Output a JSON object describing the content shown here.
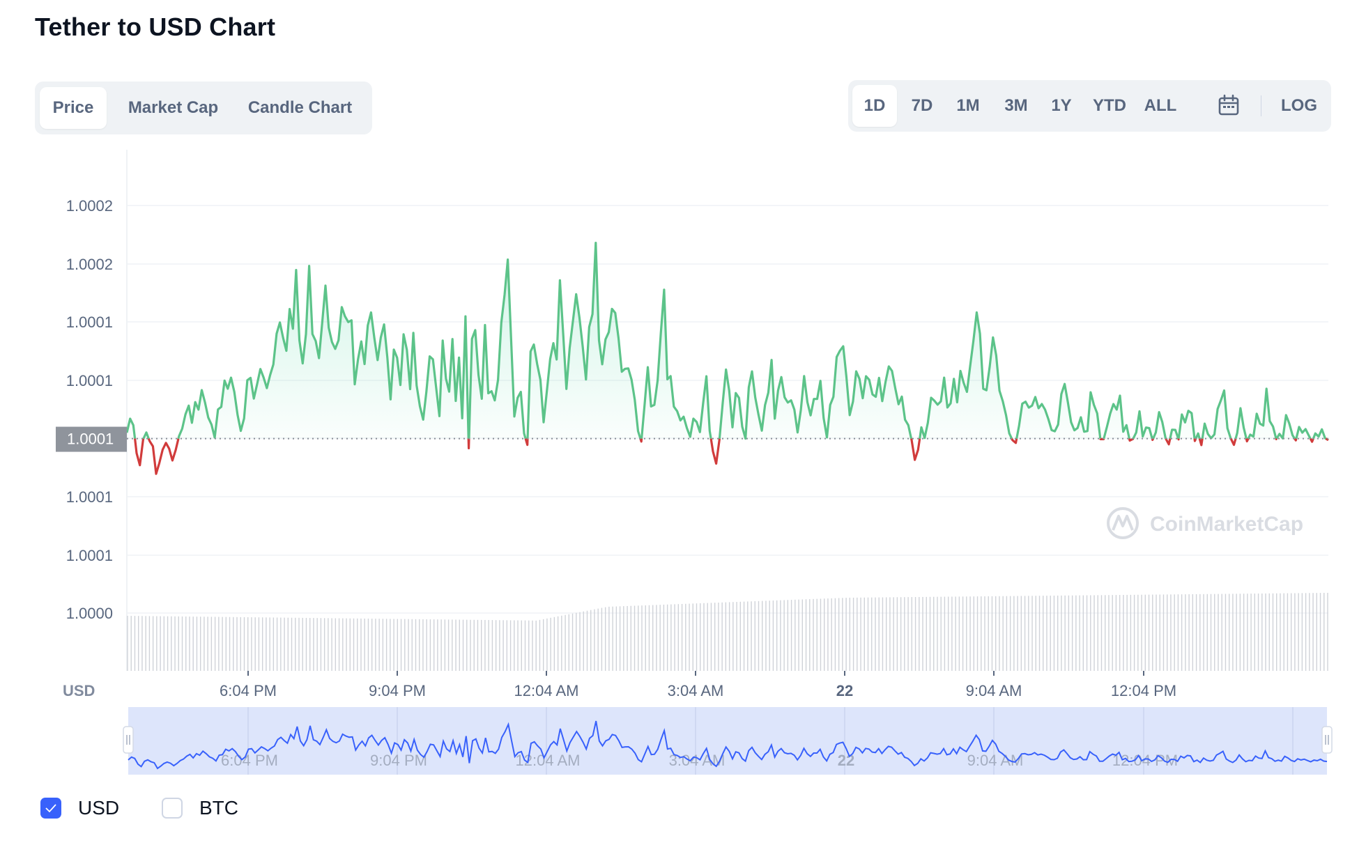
{
  "page": {
    "title": "Tether to USD Chart"
  },
  "tabs": [
    {
      "label": "Price",
      "active": true
    },
    {
      "label": "Market Cap",
      "active": false
    },
    {
      "label": "Candle Chart",
      "active": false
    }
  ],
  "ranges": {
    "items": [
      {
        "label": "1D",
        "active": true
      },
      {
        "label": "7D",
        "active": false
      },
      {
        "label": "1M",
        "active": false
      },
      {
        "label": "3M",
        "active": false
      },
      {
        "label": "1Y",
        "active": false
      },
      {
        "label": "YTD",
        "active": false
      },
      {
        "label": "ALL",
        "active": false
      }
    ],
    "calendar_icon": "calendar-icon",
    "log_label": "LOG"
  },
  "watermark": "CoinMarketCap",
  "legend": [
    {
      "label": "USD",
      "checked": true
    },
    {
      "label": "BTC",
      "checked": false
    }
  ],
  "colors": {
    "up": "#16c784",
    "line_up": "#5cc389",
    "down": "#d13b3b",
    "accent": "#3861fb",
    "navigator_fill": "#dde5fb"
  },
  "chart_data": {
    "type": "line",
    "currency_label": "USD",
    "y_tick_labels": [
      "1.0002",
      "1.0002",
      "1.0001",
      "1.0001",
      "1.0001",
      "1.0001",
      "1.0001",
      "1.0000"
    ],
    "x_tick_labels": [
      "6:04 PM",
      "9:04 PM",
      "12:04 AM",
      "3:04 AM",
      "22",
      "9:04 AM",
      "12:04 PM"
    ],
    "current_price_label": "1.0001",
    "ylim": [
      1.0,
      1.000235
    ],
    "baseline": 1.0000885,
    "grid": true,
    "series": [
      {
        "values": [
          1.0000915,
          1.0000986,
          1.0000953,
          1.0000811,
          1.000075,
          1.0000881,
          1.0000916,
          1.0000872,
          1.0000846,
          1.0000706,
          1.0000762,
          1.0000829,
          1.0000863,
          1.0000834,
          1.0000774,
          1.0000827,
          1.0000897,
          1.0000935,
          1.0001008,
          1.0001052,
          1.0000965,
          1.000107,
          1.0001032,
          1.0001131,
          1.0001069,
          1.0000992,
          1.0000956,
          1.000089,
          1.0001033,
          1.0001046,
          1.0001179,
          1.0001138,
          1.0001194,
          1.0001122,
          1.0001005,
          1.0000924,
          1.0000987,
          1.0001181,
          1.0001193,
          1.0001088,
          1.0001161,
          1.0001238,
          1.0001195,
          1.0001141,
          1.0001207,
          1.0001261,
          1.0001417,
          1.0001474,
          1.0001395,
          1.000133,
          1.0001542,
          1.0001442,
          1.000174,
          1.0001384,
          1.0001266,
          1.0001415,
          1.0001761,
          1.0001415,
          1.000138,
          1.0001293,
          1.0001472,
          1.0001661,
          1.0001447,
          1.0001375,
          1.000134,
          1.0001383,
          1.0001552,
          1.0001505,
          1.0001476,
          1.0001485,
          1.000116,
          1.0001287,
          1.0001378,
          1.0001263,
          1.0001459,
          1.0001525,
          1.0001396,
          1.0001283,
          1.0001398,
          1.0001464,
          1.0001296,
          1.0001084,
          1.0001336,
          1.0001295,
          1.0001157,
          1.0001414,
          1.0001335,
          1.0001136,
          1.0001421,
          1.0001155,
          1.0001049,
          1.0000981,
          1.0001123,
          1.0001302,
          1.0001287,
          1.0001144,
          1.0000999,
          1.0001382,
          1.0001189,
          1.0001123,
          1.000139,
          1.0001076,
          1.0001296,
          1.0000988,
          1.0001505,
          1.0000836,
          1.0001391,
          1.0001435,
          1.0001207,
          1.0001087,
          1.0001461,
          1.0001115,
          1.0001125,
          1.0001079,
          1.0001183,
          1.0001473,
          1.0001615,
          1.0001793,
          1.0001394,
          1.0000997,
          1.0001092,
          1.0001122,
          1.0000911,
          1.0000853,
          1.0001327,
          1.0001362,
          1.0001264,
          1.0001183,
          1.0000968,
          1.0001127,
          1.0001288,
          1.0001369,
          1.0001286,
          1.0001688,
          1.0001416,
          1.0001137,
          1.0001345,
          1.0001482,
          1.0001617,
          1.0001499,
          1.0001352,
          1.0001185,
          1.0001451,
          1.0001516,
          1.0001878,
          1.0001383,
          1.0001262,
          1.0001388,
          1.0001425,
          1.0001543,
          1.0001522,
          1.0001394,
          1.0001224,
          1.0001239,
          1.0001241,
          1.0001183,
          1.0001082,
          1.0000923,
          1.000087,
          1.0001057,
          1.0001247,
          1.0001048,
          1.0001056,
          1.000118,
          1.000142,
          1.000164,
          1.0001186,
          1.0001202,
          1.0001047,
          1.0001024,
          1.0000977,
          1.0000996,
          1.0000938,
          1.0000894,
          1.0000986,
          1.0000969,
          1.0000918,
          1.0001068,
          1.0001201,
          1.0000924,
          1.000082,
          1.0000758,
          1.000088,
          1.0001066,
          1.0001235,
          1.0001128,
          1.0000942,
          1.0001116,
          1.0001091,
          1.0000945,
          1.0000885,
          1.0001145,
          1.0001226,
          1.0001093,
          1.0001005,
          1.0000925,
          1.0001055,
          1.0001118,
          1.0001284,
          1.0000986,
          1.0001129,
          1.0001197,
          1.0001094,
          1.0001068,
          1.0001079,
          1.0001032,
          1.0000916,
          1.000103,
          1.0001202,
          1.000107,
          1.0001003,
          1.0001086,
          1.0001086,
          1.0001178,
          1.0000989,
          1.0000891,
          1.0001056,
          1.0001097,
          1.0001299,
          1.0001331,
          1.0001353,
          1.0001197,
          1.0001004,
          1.0001073,
          1.0001226,
          1.0001188,
          1.000109,
          1.0001201,
          1.0001183,
          1.0001109,
          1.0001097,
          1.0001193,
          1.0001075,
          1.0001172,
          1.0001251,
          1.0001228,
          1.000114,
          1.0001059,
          1.0001098,
          1.0000981,
          1.0000953,
          1.0000878,
          1.0000777,
          1.0000828,
          1.0000942,
          1.0000888,
          1.0000965,
          1.0001092,
          1.0001077,
          1.0001057,
          1.0001074,
          1.0001194,
          1.0001043,
          1.0001064,
          1.0001188,
          1.0001069,
          1.0001228,
          1.0001168,
          1.0001122,
          1.0001255,
          1.0001381,
          1.0001525,
          1.0001417,
          1.0001138,
          1.000113,
          1.0001251,
          1.0001398,
          1.0001307,
          1.0001128,
          1.0001075,
          1.0001004,
          1.0000912,
          1.0000877,
          1.0000863,
          1.000095,
          1.0001062,
          1.0001072,
          1.0001042,
          1.0001052,
          1.0001096,
          1.0001039,
          1.000106,
          1.0001032,
          1.0000984,
          1.0000928,
          1.0000922,
          1.0000956,
          1.0001111,
          1.0001162,
          1.000107,
          1.0000968,
          1.0000927,
          1.0000939,
          1.0000993,
          1.000092,
          1.0000923,
          1.000112,
          1.0001056,
          1.0001013,
          1.0000882,
          1.0000882,
          1.0000945,
          1.0001012,
          1.000106,
          1.0001032,
          1.0001103,
          1.000092,
          1.0000953,
          1.0000875,
          1.0000883,
          1.0000916,
          1.0001023,
          1.0000896,
          1.0000941,
          1.0000938,
          1.0000878,
          1.0000916,
          1.0001019,
          1.0000969,
          1.0000887,
          1.0000856,
          1.000093,
          1.0000929,
          1.0000881,
          1.0001007,
          1.0000967,
          1.0001026,
          1.0001014,
          1.0000873,
          1.0000911,
          1.0000852,
          1.0000961,
          1.0000909,
          1.0000887,
          1.0000906,
          1.0001035,
          1.0001079,
          1.0001129,
          1.0000937,
          1.0000887,
          1.0000853,
          1.0000913,
          1.0001039,
          1.0000941,
          1.0000871,
          1.0000905,
          1.0000895,
          1.0001011,
          1.0000961,
          1.0000951,
          1.0001138,
          1.0000974,
          1.0000946,
          1.0000882,
          1.0000909,
          1.0000886,
          1.0001004,
          1.0000962,
          1.0000902,
          1.0000876,
          1.0000944,
          1.0000915,
          1.0000933,
          1.00009,
          1.0000869,
          1.0000911,
          1.0000895,
          1.0000932,
          1.0000887,
          1.0000877
        ]
      }
    ]
  }
}
